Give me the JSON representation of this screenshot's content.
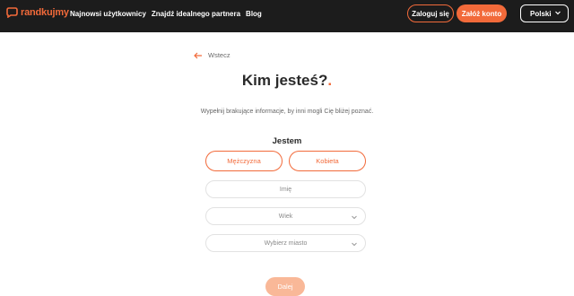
{
  "brand": {
    "name": "randkujmy",
    "accent": "#f26a3a"
  },
  "nav": [
    "Najnowsi użytkownicy",
    "Znajdź idealnego partnera",
    "Blog"
  ],
  "header": {
    "login_label": "Zaloguj się",
    "register_label": "Załóż konto",
    "language": "Polski"
  },
  "back_label": "Wstecz",
  "title": "Kim jesteś?",
  "title_dot": ".",
  "subtitle": "Wypełnij brakujące informacje, by inni mogli Cię bliżej poznać.",
  "gender": {
    "label": "Jestem",
    "options": [
      "Mężczyzna",
      "Kobieta"
    ]
  },
  "fields": {
    "name_placeholder": "Imię",
    "age_placeholder": "Wiek",
    "city_placeholder": "Wybierz miasto"
  },
  "next_label": "Dalej",
  "icons": {
    "logo": "heart-chat-icon",
    "back": "arrow-left-icon",
    "dropdown": "chevron-down-icon"
  }
}
